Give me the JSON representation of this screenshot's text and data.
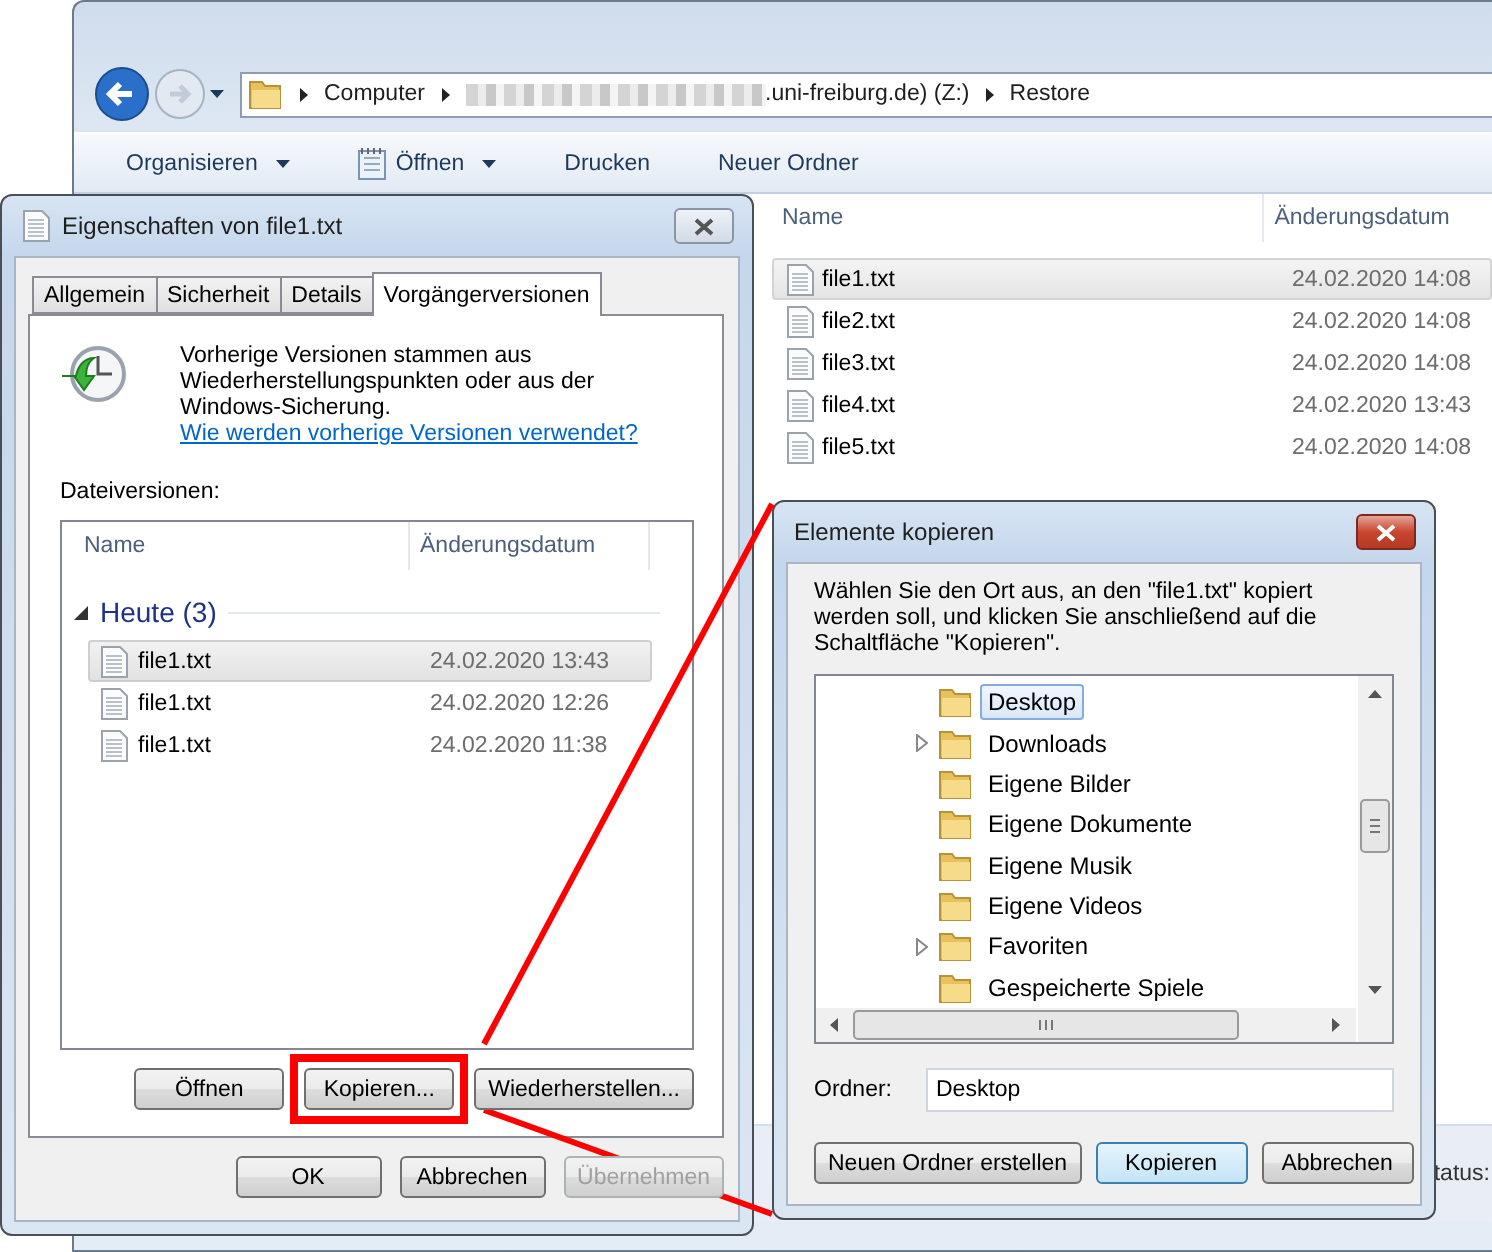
{
  "explorer": {
    "address_segments": [
      {
        "label": "Computer",
        "redacted": false
      },
      {
        "label": ".uni-freiburg.de) (Z:)",
        "redacted": true
      },
      {
        "label": "Restore",
        "redacted": false
      }
    ],
    "toolbar": [
      {
        "label": "Organisieren",
        "dropdown": true,
        "icon": false
      },
      {
        "label": "Öffnen",
        "dropdown": true,
        "icon": true
      },
      {
        "label": "Drucken",
        "dropdown": false,
        "icon": false
      },
      {
        "label": "Neuer Ordner",
        "dropdown": false,
        "icon": false
      }
    ],
    "columns": [
      "Name",
      "Änderungsdatum"
    ],
    "files": [
      {
        "name": "file1.txt",
        "date": "24.02.2020 14:08",
        "selected": true
      },
      {
        "name": "file2.txt",
        "date": "24.02.2020 14:08",
        "selected": false
      },
      {
        "name": "file3.txt",
        "date": "24.02.2020 14:08",
        "selected": false
      },
      {
        "name": "file4.txt",
        "date": "24.02.2020 13:43",
        "selected": false
      },
      {
        "name": "file5.txt",
        "date": "24.02.2020 14:08",
        "selected": false
      }
    ],
    "status_bar": "tatus:"
  },
  "properties_dialog": {
    "title": "Eigenschaften von file1.txt",
    "tabs": [
      {
        "label": "Allgemein",
        "selected": false
      },
      {
        "label": "Sicherheit",
        "selected": false
      },
      {
        "label": "Details",
        "selected": false
      },
      {
        "label": "Vorgängerversionen",
        "selected": true
      }
    ],
    "intro": "Vorherige Versionen stammen aus Wiederherstellungspunkten oder aus der Windows-Sicherung.",
    "help_link": "Wie werden vorherige Versionen verwendet?",
    "list_label": "Dateiversionen:",
    "columns": [
      "Name",
      "Änderungsdatum"
    ],
    "group": {
      "label": "Heute (3)",
      "expanded": true
    },
    "versions": [
      {
        "name": "file1.txt",
        "date": "24.02.2020 13:43",
        "selected": true
      },
      {
        "name": "file1.txt",
        "date": "24.02.2020 12:26",
        "selected": false
      },
      {
        "name": "file1.txt",
        "date": "24.02.2020 11:38",
        "selected": false
      }
    ],
    "actions": [
      {
        "label": "Öffnen",
        "highlighted": false
      },
      {
        "label": "Kopieren...",
        "highlighted": true
      },
      {
        "label": "Wiederherstellen...",
        "highlighted": false
      }
    ],
    "buttons": [
      {
        "label": "OK",
        "disabled": false
      },
      {
        "label": "Abbrechen",
        "disabled": false
      },
      {
        "label": "Übernehmen",
        "disabled": true
      }
    ]
  },
  "copy_dialog": {
    "title": "Elemente kopieren",
    "instruction": "Wählen Sie den Ort aus, an den \"file1.txt\" kopiert werden soll, und klicken Sie anschließend auf die Schaltfläche \"Kopieren\".",
    "folders": [
      {
        "name": "Desktop",
        "expandable": false,
        "selected": true
      },
      {
        "name": "Downloads",
        "expandable": true,
        "selected": false
      },
      {
        "name": "Eigene Bilder",
        "expandable": false,
        "selected": false
      },
      {
        "name": "Eigene Dokumente",
        "expandable": false,
        "selected": false
      },
      {
        "name": "Eigene Musik",
        "expandable": false,
        "selected": false
      },
      {
        "name": "Eigene Videos",
        "expandable": false,
        "selected": false
      },
      {
        "name": "Favoriten",
        "expandable": true,
        "selected": false
      },
      {
        "name": "Gespeicherte Spiele",
        "expandable": false,
        "selected": false
      }
    ],
    "folder_label": "Ordner:",
    "folder_value": "Desktop",
    "buttons": [
      {
        "label": "Neuen Ordner erstellen",
        "default": false
      },
      {
        "label": "Kopieren",
        "default": true
      },
      {
        "label": "Abbrechen",
        "default": false
      }
    ]
  }
}
